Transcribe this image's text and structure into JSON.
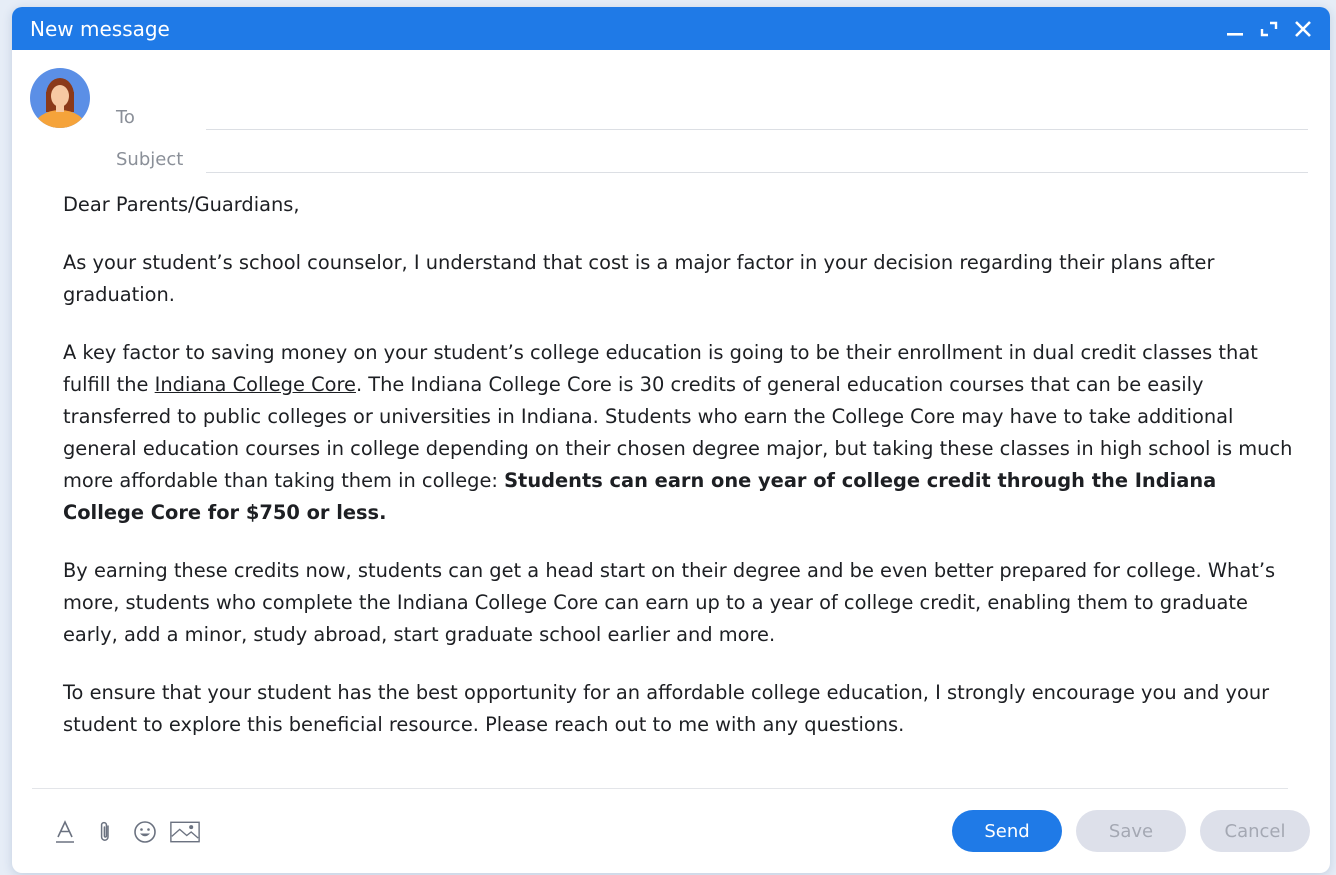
{
  "window": {
    "title": "New message"
  },
  "header": {
    "to_label": "To",
    "subject_label": "Subject",
    "to_value": "",
    "subject_value": ""
  },
  "body": {
    "greeting": "Dear Parents/Guardians,",
    "paragraph1": "As your student’s school counselor, I understand that cost is a major factor in your decision regarding their plans after graduation.",
    "paragraph2_part1": "A key factor to saving money on your student’s college education is going to be their enrollment in dual credit classes that fulfill the ",
    "paragraph2_link": "Indiana College Core",
    "paragraph2_part2": ". The Indiana College Core is 30 credits of general education courses that can be easily transferred to public colleges or universities in Indiana. Students who earn the College Core may have to take additional general education courses in college depending on their chosen degree major, but taking these classes in high school is much more affordable than taking them in college: ",
    "paragraph2_bold": "Students can earn one year of college credit through the Indiana College Core for $750 or less.",
    "paragraph3": "By earning these credits now, students can get a head start on their degree and be even better prepared for college. What’s more, students who complete the Indiana College Core can earn up to a year of college credit, enabling them to graduate early, add a minor, study abroad, start graduate school earlier and more.",
    "paragraph4": "To ensure that your student has the best opportunity for an affordable college education, I strongly encourage you and your student to explore this beneficial resource. Please reach out to me with any questions."
  },
  "toolbar": {
    "icons": [
      "text-format-icon",
      "attachment-icon",
      "emoji-icon",
      "image-icon"
    ]
  },
  "actions": {
    "send_label": "Send",
    "save_label": "Save",
    "cancel_label": "Cancel"
  },
  "colors": {
    "accent": "#1f7ae7",
    "muted_button": "#dde0ea",
    "muted_text": "#a4a8b3"
  }
}
